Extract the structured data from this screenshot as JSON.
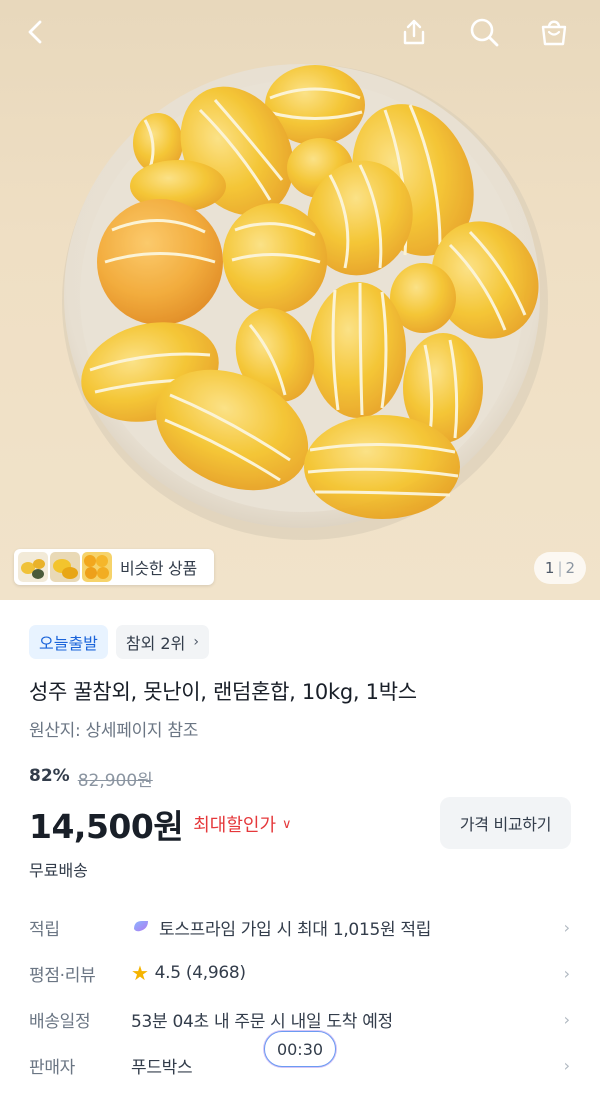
{
  "header": {
    "back_icon": "chevron-left-icon",
    "share_icon": "share-icon",
    "search_icon": "search-icon",
    "cart_icon": "shopping-bag-icon"
  },
  "gallery": {
    "image_alt": "yellow oriental melons in a white bowl",
    "similar_label": "비슷한 상품",
    "page_current": "1",
    "page_total": "2"
  },
  "tags": [
    {
      "label": "오늘출발"
    },
    {
      "label": "참외 2위"
    }
  ],
  "product": {
    "title": "성주 꿀참외, 못난이, 랜덤혼합, 10kg, 1박스",
    "origin": "원산지: 상세페이지 참조",
    "discount_rate": "82%",
    "original_price": "82,900원",
    "price": "14,500원",
    "max_discount_label": "최대할인가",
    "compare_button": "가격 비교하기",
    "shipping": "무료배송"
  },
  "info_rows": [
    {
      "key": "적립",
      "value": "토스프라임 가입 시 최대 1,015원 적립"
    },
    {
      "key": "평점·리뷰",
      "value": "4.5 (4,968)"
    },
    {
      "key": "배송일정",
      "value": "53분 04초 내 주문 시 내일 도착 예정"
    },
    {
      "key": "판매자",
      "value": "푸드박스"
    }
  ],
  "timer": "00:30",
  "colors": {
    "accent_blue": "#1b64da",
    "sale_red": "#e5383b",
    "star": "#f5b400",
    "melon_yellow": "#f7c21c"
  }
}
